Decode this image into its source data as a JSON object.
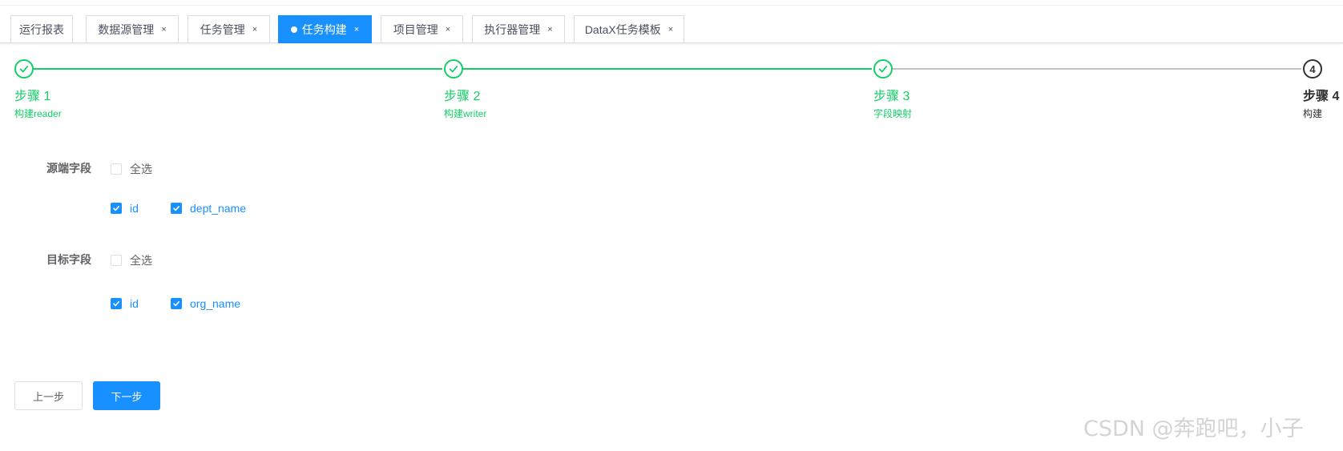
{
  "tabs": [
    {
      "label": "运行报表",
      "closable": false,
      "active": false
    },
    {
      "label": "数据源管理",
      "closable": true,
      "active": false
    },
    {
      "label": "任务管理",
      "closable": true,
      "active": false
    },
    {
      "label": "任务构建",
      "closable": true,
      "active": true
    },
    {
      "label": "项目管理",
      "closable": true,
      "active": false
    },
    {
      "label": "执行器管理",
      "closable": true,
      "active": false
    },
    {
      "label": "DataX任务模板",
      "closable": true,
      "active": false
    }
  ],
  "tab_close_glyph": "×",
  "steps": [
    {
      "title": "步骤 1",
      "description": "构建reader",
      "status": "finished"
    },
    {
      "title": "步骤 2",
      "description": "构建writer",
      "status": "finished"
    },
    {
      "title": "步骤 3",
      "description": "字段映射",
      "status": "finished"
    },
    {
      "title": "步骤 4",
      "description": "构建",
      "status": "current",
      "number": "4"
    }
  ],
  "source_fields": {
    "label": "源端字段",
    "select_all": {
      "label": "全选",
      "checked": false
    },
    "fields": [
      {
        "label": "id",
        "checked": true
      },
      {
        "label": "dept_name",
        "checked": true
      }
    ]
  },
  "target_fields": {
    "label": "目标字段",
    "select_all": {
      "label": "全选",
      "checked": false
    },
    "fields": [
      {
        "label": "id",
        "checked": true
      },
      {
        "label": "org_name",
        "checked": true
      }
    ]
  },
  "buttons": {
    "prev": "上一步",
    "next": "下一步"
  },
  "watermark": "CSDN @奔跑吧，小子",
  "colors": {
    "primary": "#1890ff",
    "success": "#13ce66",
    "line_pending": "#c0c4cc",
    "text": "#606266"
  }
}
